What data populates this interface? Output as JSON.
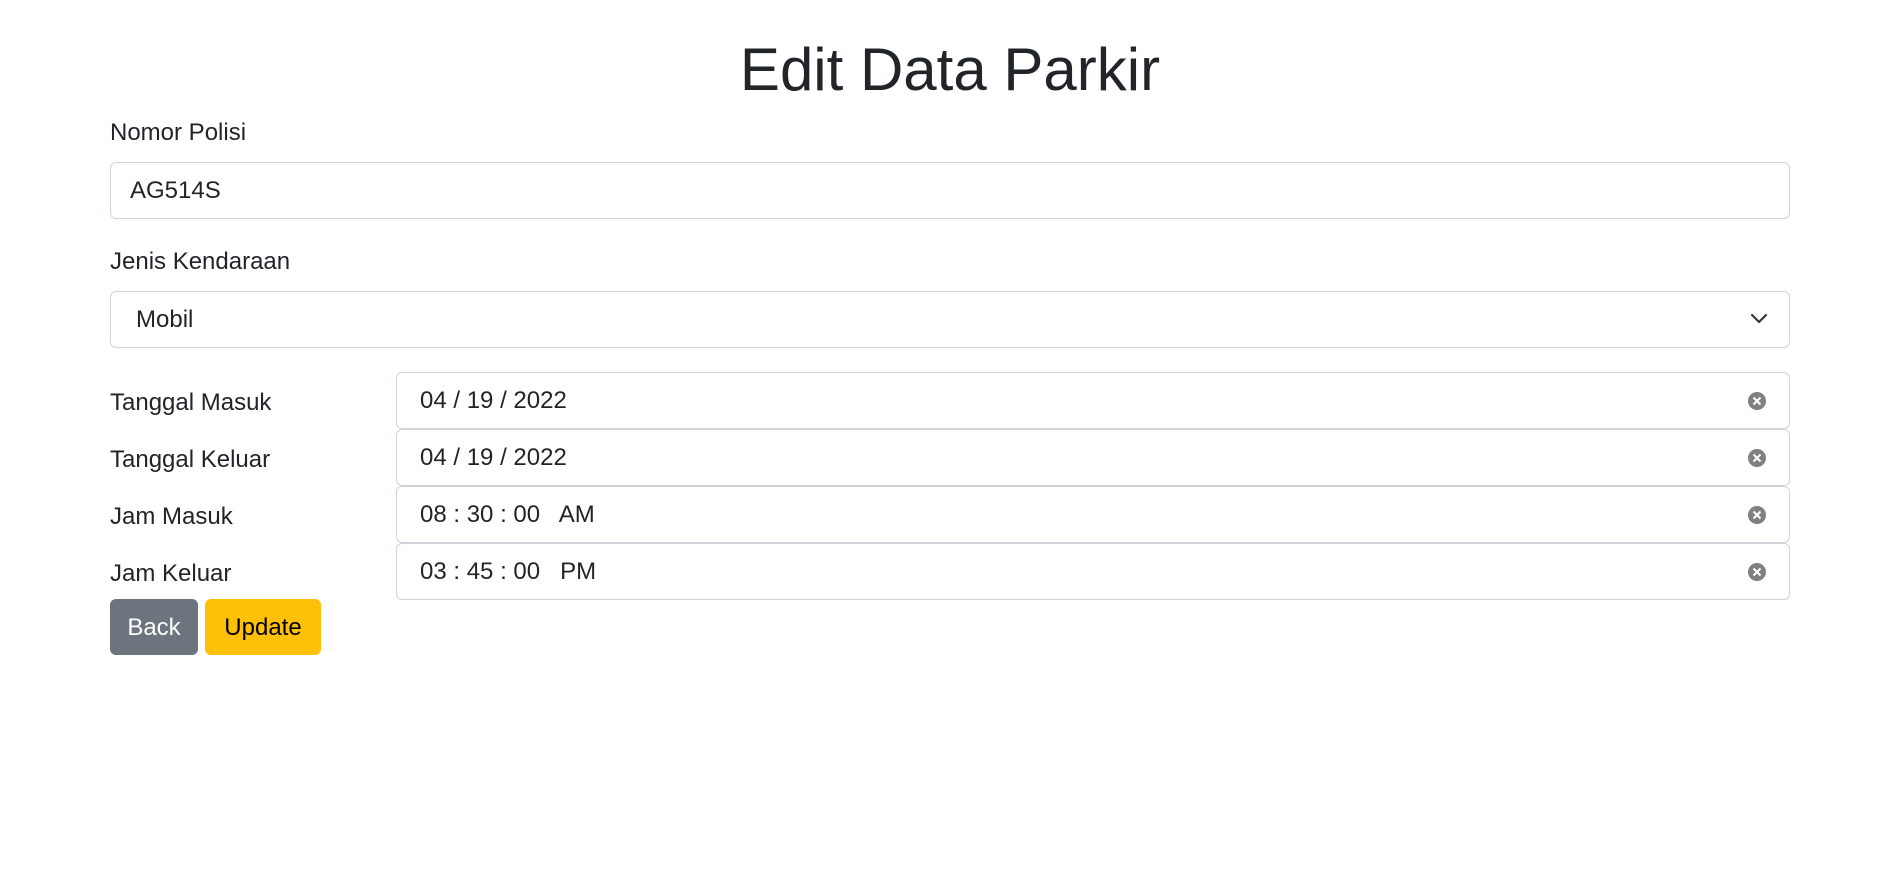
{
  "page": {
    "title": "Edit Data Parkir"
  },
  "form": {
    "nomor_polisi": {
      "label": "Nomor Polisi",
      "value": "AG514S"
    },
    "jenis_kendaraan": {
      "label": "Jenis Kendaraan",
      "selected": "Mobil",
      "icon": "chevron-down-icon"
    },
    "tanggal_masuk": {
      "label": "Tanggal Masuk",
      "value": "04 / 19 / 2022",
      "icon": "clear-icon"
    },
    "tanggal_keluar": {
      "label": "Tanggal Keluar",
      "value": "04 / 19 / 2022",
      "icon": "clear-icon"
    },
    "jam_masuk": {
      "label": "Jam Masuk",
      "value": "08 : 30 : 00   AM",
      "icon": "clear-icon"
    },
    "jam_keluar": {
      "label": "Jam Keluar",
      "value": "03 : 45 : 00   PM",
      "icon": "clear-icon"
    }
  },
  "actions": {
    "back_label": "Back",
    "update_label": "Update"
  },
  "colors": {
    "back_button": "#6c757d",
    "update_button": "#ffc107",
    "border": "#ced4da",
    "text": "#212529"
  }
}
